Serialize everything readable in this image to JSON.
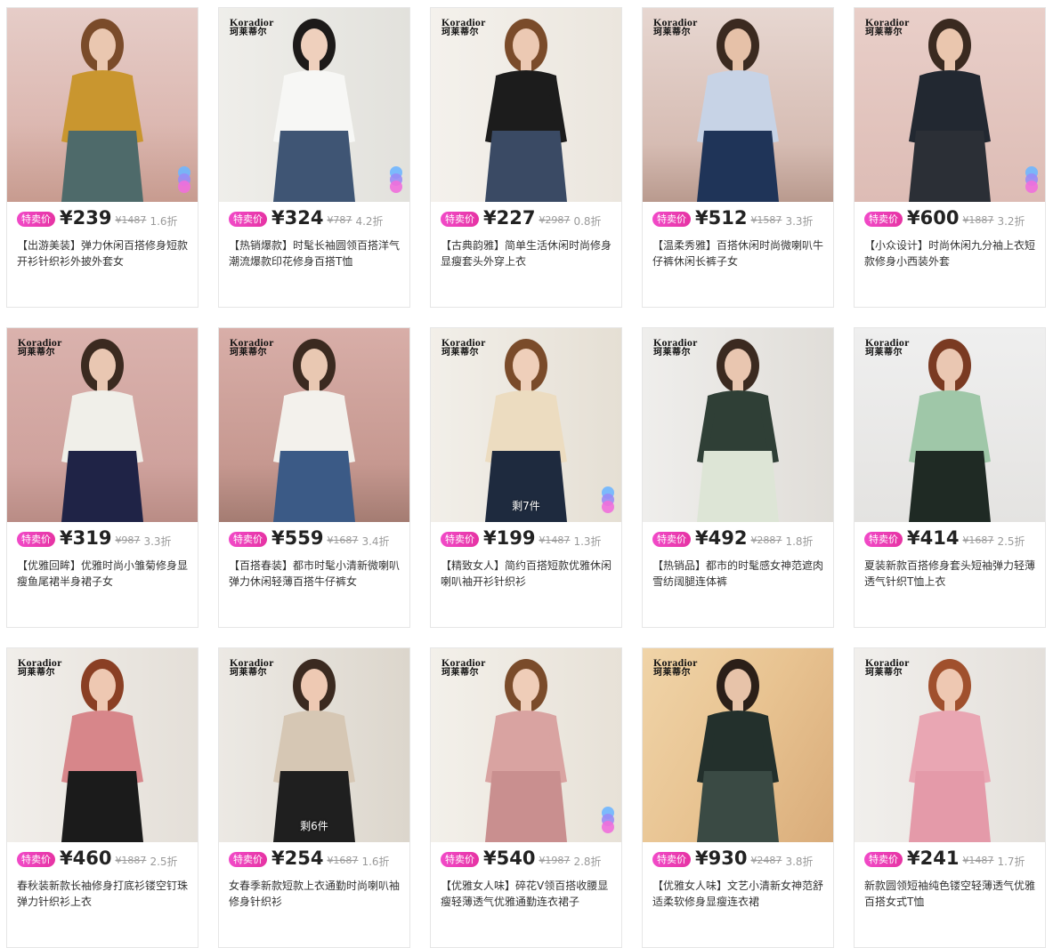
{
  "brand": {
    "en": "Koradior",
    "cn": "珂莱蒂尔"
  },
  "price_tag": "特卖价",
  "colors": {
    "tag": "#e633a3",
    "dots": [
      "#6fb6ff",
      "#9a8cf5",
      "#f06fdc"
    ]
  },
  "products": [
    {
      "price": "¥239",
      "orig": "¥1487",
      "disc": "1.6折",
      "title": "【出游美装】弹力休闲百搭修身短款开衫针织衫外披外套女",
      "logo": false,
      "dots": true,
      "stock": ""
    },
    {
      "price": "¥324",
      "orig": "¥787",
      "disc": "4.2折",
      "title": "【热销爆款】时髦长袖圆领百搭洋气潮流爆款印花修身百搭T恤",
      "logo": true,
      "dots": true,
      "stock": ""
    },
    {
      "price": "¥227",
      "orig": "¥2987",
      "disc": "0.8折",
      "title": "【古典韵雅】简单生活休闲时尚修身显瘦套头外穿上衣",
      "logo": true,
      "dots": false,
      "stock": ""
    },
    {
      "price": "¥512",
      "orig": "¥1587",
      "disc": "3.3折",
      "title": "【温柔秀雅】百搭休闲时尚微喇叭牛仔裤休闲长裤子女",
      "logo": true,
      "dots": false,
      "stock": ""
    },
    {
      "price": "¥600",
      "orig": "¥1887",
      "disc": "3.2折",
      "title": "【小众设计】时尚休闲九分袖上衣短款修身小西装外套",
      "logo": true,
      "dots": true,
      "stock": ""
    },
    {
      "price": "¥319",
      "orig": "¥987",
      "disc": "3.3折",
      "title": "【优雅回眸】优雅时尚小雏菊修身显瘦鱼尾裙半身裙子女",
      "logo": true,
      "dots": false,
      "stock": ""
    },
    {
      "price": "¥559",
      "orig": "¥1687",
      "disc": "3.4折",
      "title": "【百搭春装】都市时髦小清新微喇叭弹力休闲轻薄百搭牛仔裤女",
      "logo": true,
      "dots": false,
      "stock": ""
    },
    {
      "price": "¥199",
      "orig": "¥1487",
      "disc": "1.3折",
      "title": "【精致女人】简约百搭短款优雅休闲喇叭袖开衫针织衫",
      "logo": true,
      "dots": true,
      "stock": "剩7件"
    },
    {
      "price": "¥492",
      "orig": "¥2887",
      "disc": "1.8折",
      "title": "【热销品】都市的时髦感女神范遮肉雪纺阔腿连体裤",
      "logo": true,
      "dots": false,
      "stock": ""
    },
    {
      "price": "¥414",
      "orig": "¥1687",
      "disc": "2.5折",
      "title": "夏装新款百搭修身套头短袖弹力轻薄透气针织T恤上衣",
      "logo": true,
      "dots": false,
      "stock": ""
    },
    {
      "price": "¥460",
      "orig": "¥1887",
      "disc": "2.5折",
      "title": "春秋装新款长袖修身打底衫镂空钉珠弹力针织衫上衣",
      "logo": true,
      "dots": false,
      "stock": ""
    },
    {
      "price": "¥254",
      "orig": "¥1687",
      "disc": "1.6折",
      "title": "女春季新款短款上衣通勤时尚喇叭袖修身针织衫",
      "logo": true,
      "dots": false,
      "stock": "剩6件"
    },
    {
      "price": "¥540",
      "orig": "¥1987",
      "disc": "2.8折",
      "title": "【优雅女人味】碎花V领百搭收腰显瘦轻薄透气优雅通勤连衣裙子",
      "logo": true,
      "dots": true,
      "stock": ""
    },
    {
      "price": "¥930",
      "orig": "¥2487",
      "disc": "3.8折",
      "title": "【优雅女人味】文艺小清新女神范舒适柔软修身显瘦连衣裙",
      "logo": true,
      "dots": false,
      "stock": ""
    },
    {
      "price": "¥241",
      "orig": "¥1487",
      "disc": "1.7折",
      "title": "新款圆领短袖纯色镂空轻薄透气优雅百搭女式T恤",
      "logo": true,
      "dots": false,
      "stock": ""
    }
  ]
}
